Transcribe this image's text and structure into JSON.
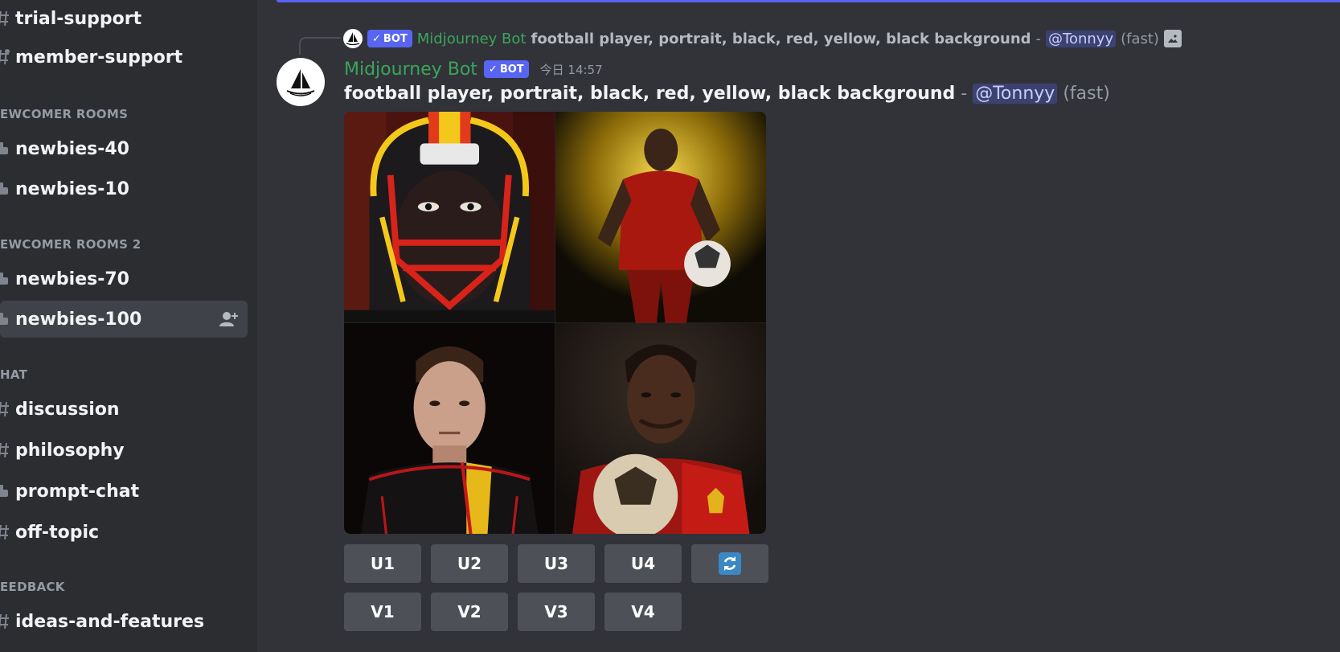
{
  "sidebar": {
    "items": [
      {
        "type": "channel",
        "icon": "hashtag-icon",
        "label": "trial-support"
      },
      {
        "type": "channel",
        "icon": "forum-hashtag-icon",
        "label": "member-support"
      },
      {
        "type": "category",
        "label": "EWCOMER ROOMS"
      },
      {
        "type": "channel",
        "icon": "thread-icon",
        "label": "newbies-40"
      },
      {
        "type": "channel",
        "icon": "thread-icon",
        "label": "newbies-10"
      },
      {
        "type": "category",
        "label": "EWCOMER ROOMS 2"
      },
      {
        "type": "channel",
        "icon": "thread-icon",
        "label": "newbies-70"
      },
      {
        "type": "channel",
        "icon": "thread-icon",
        "label": "newbies-100",
        "selected": true
      },
      {
        "type": "category",
        "label": "HAT"
      },
      {
        "type": "channel",
        "icon": "hashtag-icon",
        "label": "discussion"
      },
      {
        "type": "channel",
        "icon": "hashtag-icon",
        "label": "philosophy"
      },
      {
        "type": "channel",
        "icon": "thread-icon",
        "label": "prompt-chat"
      },
      {
        "type": "channel",
        "icon": "hashtag-icon",
        "label": "off-topic"
      },
      {
        "type": "category",
        "label": "EEDBACK"
      },
      {
        "type": "channel",
        "icon": "hashtag-icon",
        "label": "ideas-and-features"
      }
    ]
  },
  "message": {
    "reply": {
      "bot_tag": "BOT",
      "author": "Midjourney Bot",
      "prompt": "football player, portrait, black, red, yellow, black background",
      "separator": " - ",
      "mention": "@Tonnyy",
      "mode": "(fast)"
    },
    "author": "Midjourney Bot",
    "bot_tag": "BOT",
    "timestamp": "今日 14:57",
    "prompt": "football player, portrait, black, red, yellow, black background",
    "separator": " - ",
    "mention": "@Tonnyy",
    "mode": "(fast)",
    "images": [
      {
        "name": "football-helmet-portrait"
      },
      {
        "name": "soccer-player-yellow-smoke"
      },
      {
        "name": "player-black-yellow-jersey"
      },
      {
        "name": "player-holding-ball"
      }
    ]
  },
  "buttons": {
    "upscale": [
      "U1",
      "U2",
      "U3",
      "U4"
    ],
    "variation": [
      "V1",
      "V2",
      "V3",
      "V4"
    ],
    "reroll_icon": "refresh-icon"
  },
  "colors": {
    "accent": "#5865f2",
    "bot_name": "#3ba55c",
    "background": "#313338",
    "sidebar": "#2b2d31",
    "button": "#4e5058"
  }
}
